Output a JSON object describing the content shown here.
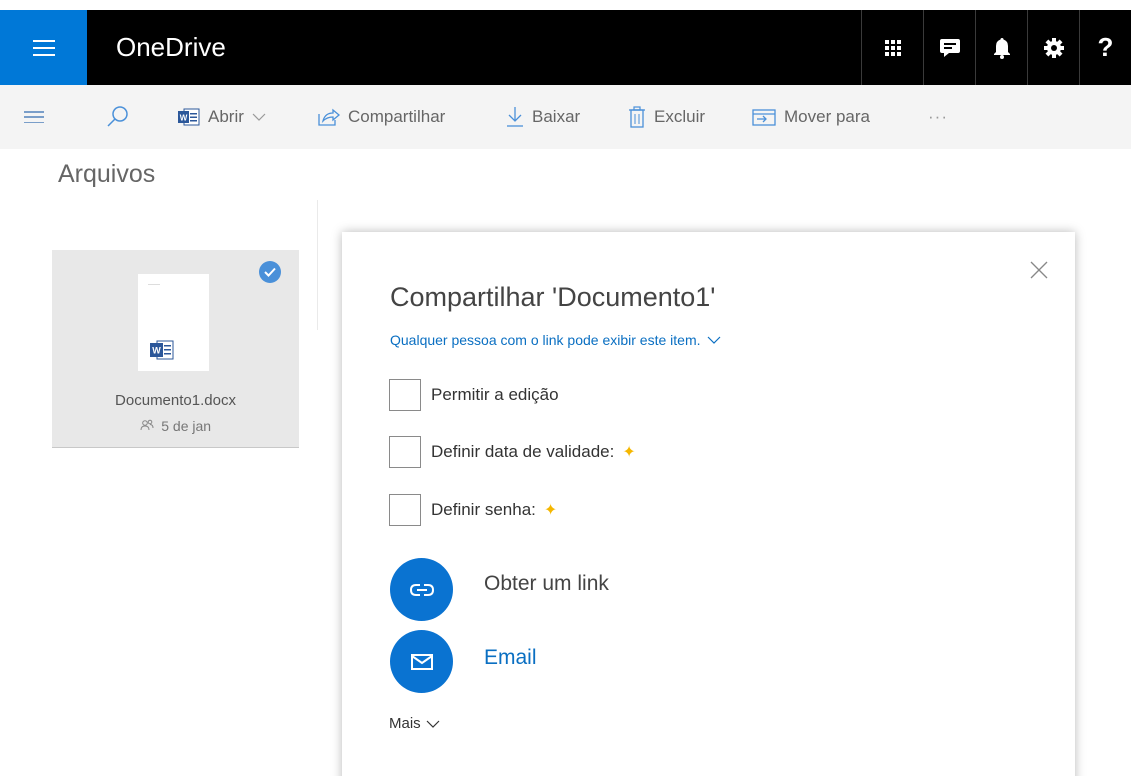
{
  "suitebar": {
    "brand": "OneDrive",
    "help_label": "?"
  },
  "commandbar": {
    "open_label": "Abrir",
    "share_label": "Compartilhar",
    "download_label": "Baixar",
    "delete_label": "Excluir",
    "move_label": "Mover para",
    "more_label": "···"
  },
  "page": {
    "heading": "Arquivos"
  },
  "file": {
    "name": "Documento1.docx",
    "date": "5 de jan",
    "selected": true
  },
  "share_panel": {
    "title": "Compartilhar 'Documento1'",
    "link_permission": "Qualquer pessoa com o link pode exibir este item.",
    "options": [
      {
        "label": "Permitir a edição",
        "checked": false,
        "premium": false
      },
      {
        "label": "Definir data de validade:",
        "checked": false,
        "premium": true
      },
      {
        "label": "Definir senha:",
        "checked": false,
        "premium": true
      }
    ],
    "premium_symbol": "✦",
    "get_link_label": "Obter um link",
    "email_label": "Email",
    "more_label": "Mais"
  },
  "colors": {
    "brand_blue": "#0078d7",
    "link_blue": "#0a6fc2",
    "action_blue": "#0a73d1",
    "premium_star": "#f5b700",
    "suitebar_bg": "#000000"
  },
  "icons": {
    "suitebar": [
      "app-launcher-icon",
      "apps-grid-icon",
      "feedback-icon",
      "bell-icon",
      "gear-icon",
      "help-icon"
    ],
    "commandbar": [
      "hamburger-icon",
      "search-icon",
      "word-icon",
      "chevron-down-icon",
      "share-icon",
      "download-icon",
      "trash-icon",
      "move-icon"
    ],
    "panel": [
      "close-icon",
      "link-icon",
      "mail-icon",
      "chevron-down-icon"
    ]
  }
}
